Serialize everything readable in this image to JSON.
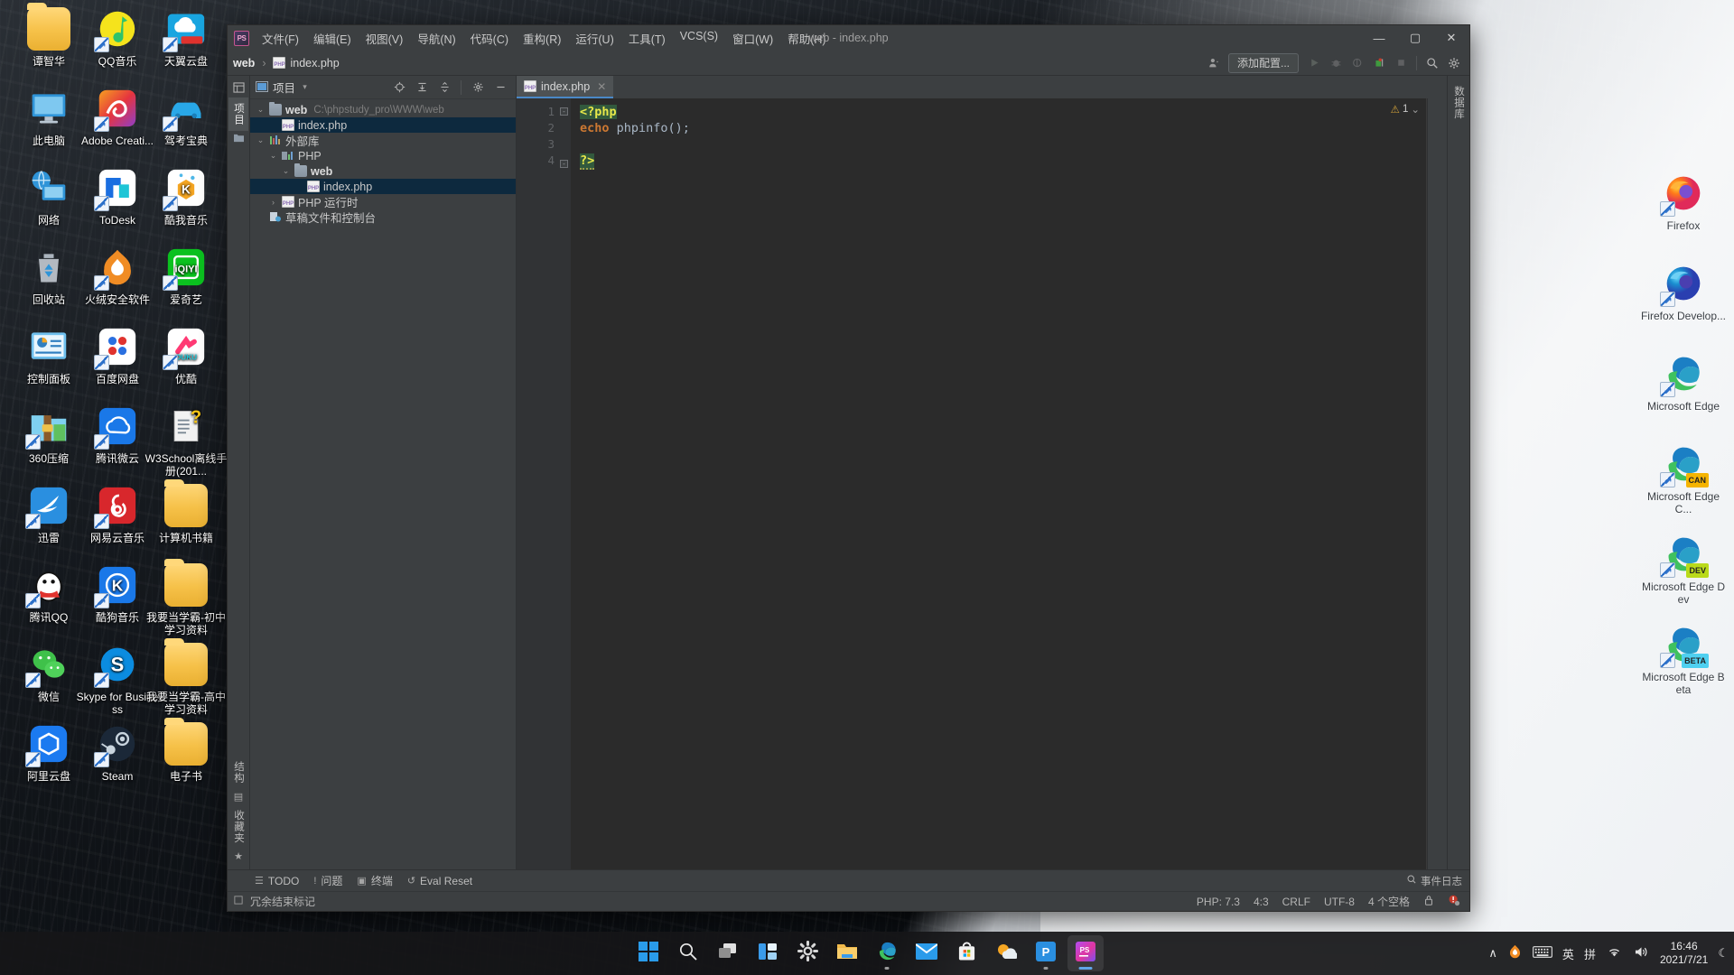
{
  "desktop": {
    "icons_left": [
      {
        "label": "谭智华",
        "type": "folder",
        "shortcut": false
      },
      {
        "label": "QQ音乐",
        "type": "qqmusic",
        "shortcut": true
      },
      {
        "label": "天翼云盘",
        "type": "tianyi",
        "shortcut": true
      },
      {
        "label": "此电脑",
        "type": "computer",
        "shortcut": false
      },
      {
        "label": "Adobe Creati...",
        "type": "adobe",
        "shortcut": true
      },
      {
        "label": "驾考宝典",
        "type": "jiakao",
        "shortcut": true
      },
      {
        "label": "网络",
        "type": "network",
        "shortcut": false
      },
      {
        "label": "ToDesk",
        "type": "todesk",
        "shortcut": true
      },
      {
        "label": "酷我音乐",
        "type": "kuwo",
        "shortcut": true
      },
      {
        "label": "回收站",
        "type": "recycle",
        "shortcut": false
      },
      {
        "label": "火绒安全软件",
        "type": "huorong",
        "shortcut": true
      },
      {
        "label": "爱奇艺",
        "type": "iqiyi",
        "shortcut": true
      },
      {
        "label": "控制面板",
        "type": "controlpanel",
        "shortcut": false
      },
      {
        "label": "百度网盘",
        "type": "baidu",
        "shortcut": true
      },
      {
        "label": "优酷",
        "type": "youku",
        "shortcut": true
      },
      {
        "label": "360压缩",
        "type": "zip360",
        "shortcut": true
      },
      {
        "label": "腾讯微云",
        "type": "weiyun",
        "shortcut": true
      },
      {
        "label": "W3School离线手册(201...",
        "type": "chm",
        "shortcut": false
      },
      {
        "label": "迅雷",
        "type": "xunlei",
        "shortcut": true
      },
      {
        "label": "网易云音乐",
        "type": "netease",
        "shortcut": true
      },
      {
        "label": "计算机书籍",
        "type": "folder",
        "shortcut": false
      },
      {
        "label": "腾讯QQ",
        "type": "qq",
        "shortcut": true
      },
      {
        "label": "酷狗音乐",
        "type": "kugou",
        "shortcut": true
      },
      {
        "label": "我要当学霸-初中学习资料",
        "type": "folder",
        "shortcut": false
      },
      {
        "label": "微信",
        "type": "wechat",
        "shortcut": true
      },
      {
        "label": "Skype for Business",
        "type": "skype",
        "shortcut": true
      },
      {
        "label": "我要当学霸-高中学习资料",
        "type": "folder",
        "shortcut": false
      },
      {
        "label": "阿里云盘",
        "type": "aliyun",
        "shortcut": true
      },
      {
        "label": "Steam",
        "type": "steam",
        "shortcut": true
      },
      {
        "label": "电子书",
        "type": "folder",
        "shortcut": false
      }
    ],
    "icons_right": [
      {
        "label": "Firefox",
        "type": "firefox",
        "badge": ""
      },
      {
        "label": "Firefox Develop...",
        "type": "firefoxdev",
        "badge": ""
      },
      {
        "label": "Microsoft Edge",
        "type": "edge",
        "badge": ""
      },
      {
        "label": "Microsoft Edge C...",
        "type": "edge",
        "badge": "CAN"
      },
      {
        "label": "Microsoft Edge Dev",
        "type": "edge",
        "badge": "DEV"
      },
      {
        "label": "Microsoft Edge Beta",
        "type": "edge",
        "badge": "BETA"
      }
    ]
  },
  "ide": {
    "window_title": "web - index.php",
    "logo_text": "PS",
    "menu": [
      "文件(F)",
      "编辑(E)",
      "视图(V)",
      "导航(N)",
      "代码(C)",
      "重构(R)",
      "运行(U)",
      "工具(T)",
      "VCS(S)",
      "窗口(W)",
      "帮助(H)"
    ],
    "window_controls": {
      "minimize": "—",
      "maximize": "▢",
      "close": "✕"
    },
    "breadcrumb": {
      "project": "web",
      "separator": "›",
      "file": "index.php"
    },
    "toolbar": {
      "run_config_label": "添加配置...",
      "run": "▶",
      "debug": "🐞",
      "coverage": "▶",
      "profile": "▶",
      "stop": "■",
      "search": "🔍",
      "settings": "⚙",
      "profiler": "👤"
    },
    "left_strip": {
      "project_tab": "项目",
      "structure_tab": "结构",
      "favorites_tab": "收藏夹"
    },
    "project_panel": {
      "title": "项目",
      "tree": [
        {
          "depth": 0,
          "arrow": "⌄",
          "icon": "folder",
          "label": "web",
          "path": "C:\\phpstudy_pro\\WWW\\web",
          "bold": true,
          "selected": false
        },
        {
          "depth": 1,
          "arrow": "",
          "icon": "php",
          "label": "index.php",
          "path": "",
          "bold": false,
          "selected": true
        },
        {
          "depth": 0,
          "arrow": "⌄",
          "icon": "lib",
          "label": "外部库",
          "path": "",
          "bold": false,
          "selected": false
        },
        {
          "depth": 1,
          "arrow": "⌄",
          "icon": "lib2",
          "label": "PHP",
          "path": "",
          "bold": false,
          "selected": false
        },
        {
          "depth": 2,
          "arrow": "⌄",
          "icon": "folder",
          "label": "web",
          "path": "",
          "bold": true,
          "selected": false
        },
        {
          "depth": 3,
          "arrow": "",
          "icon": "php",
          "label": "index.php",
          "path": "",
          "bold": false,
          "selected": true
        },
        {
          "depth": 1,
          "arrow": "›",
          "icon": "phpfolder",
          "label": "PHP 运行时",
          "path": "",
          "bold": false,
          "selected": false
        },
        {
          "depth": 0,
          "arrow": "",
          "icon": "scratch",
          "label": "草稿文件和控制台",
          "path": "",
          "bold": false,
          "selected": false
        }
      ]
    },
    "editor": {
      "tab_label": "index.php",
      "tab_close": "✕",
      "warning_count": "1",
      "warning_icon": "⚠",
      "lines": [
        {
          "num": "1",
          "segments": [
            {
              "text": "<?php",
              "cls": "tagphp hl-green"
            }
          ],
          "fold": true
        },
        {
          "num": "2",
          "segments": [
            {
              "text": "echo",
              "cls": "kw"
            },
            {
              "text": " phpinfo();",
              "cls": "fn"
            }
          ],
          "fold": false
        },
        {
          "num": "3",
          "segments": [
            {
              "text": "",
              "cls": "fn"
            }
          ],
          "fold": false
        },
        {
          "num": "4",
          "segments": [
            {
              "text": "?>",
              "cls": "tagphp hl-green squig"
            }
          ],
          "fold": true
        }
      ]
    },
    "tool_windows": [
      {
        "icon": "☰",
        "label": "TODO"
      },
      {
        "icon": "!",
        "label": "问题"
      },
      {
        "icon": "▣",
        "label": "终端"
      },
      {
        "icon": "↺",
        "label": "Eval Reset"
      }
    ],
    "event_log": {
      "icon": "🔍",
      "label": "事件日志"
    },
    "status_left": {
      "icon": "▣",
      "text": "冗余结束标记"
    },
    "status_right": [
      "PHP: 7.3",
      "4:3",
      "CRLF",
      "UTF-8",
      "4 个空格"
    ],
    "status_icons": [
      "🔒",
      "⚠"
    ]
  },
  "taskbar": {
    "buttons": [
      {
        "name": "start",
        "glyph": "windows"
      },
      {
        "name": "search",
        "glyph": "search"
      },
      {
        "name": "task-view",
        "glyph": "taskview"
      },
      {
        "name": "widgets",
        "glyph": "widgets"
      },
      {
        "name": "settings",
        "glyph": "settings"
      },
      {
        "name": "file-explorer",
        "glyph": "folder"
      },
      {
        "name": "edge",
        "glyph": "edge"
      },
      {
        "name": "mail",
        "glyph": "mail"
      },
      {
        "name": "store",
        "glyph": "store"
      },
      {
        "name": "weather",
        "glyph": "weather"
      },
      {
        "name": "phpstudy",
        "glyph": "phpstudy"
      },
      {
        "name": "phpstorm",
        "glyph": "phpstorm"
      }
    ],
    "tray": {
      "chevron": "∧",
      "huorong": "🔥",
      "keyboard": "⌨",
      "ime_lang": "英",
      "ime_mode": "拼",
      "wifi": "📶",
      "volume": "🔊",
      "time": "16:46",
      "date": "2021/7/21",
      "notification": "☾"
    }
  },
  "colors": {
    "ide_chrome": "#3c3f41",
    "editor_bg": "#2b2b2b",
    "selection": "#0d293e",
    "tab_accent": "#4a88c7",
    "highlight_green": "#32593d",
    "keyword_orange": "#cc7832",
    "php_tag_yellow": "#e8e84a"
  }
}
